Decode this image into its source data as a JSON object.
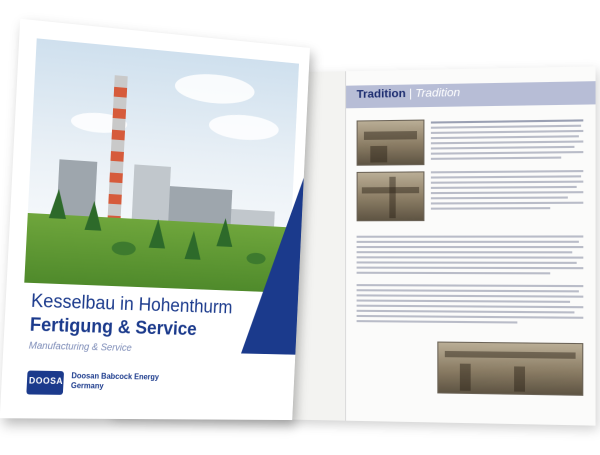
{
  "cover": {
    "title_line1": "Kesselbau in Hohenthurm",
    "title_line2": "Fertigung & Service",
    "subtitle_en": "Manufacturing & Service",
    "logo": "DOOSAN",
    "company_line1": "Doosan Babcock Energy",
    "company_line2": "Germany"
  },
  "spread": {
    "section_title": "Tradition",
    "section_separator": "|",
    "section_title_alt": "Tradition"
  },
  "colors": {
    "brand_blue": "#1b3a8c",
    "band": "#b7bdd6",
    "grass": "#4f8a2b",
    "chimney_stripe": "#d65b3b"
  }
}
